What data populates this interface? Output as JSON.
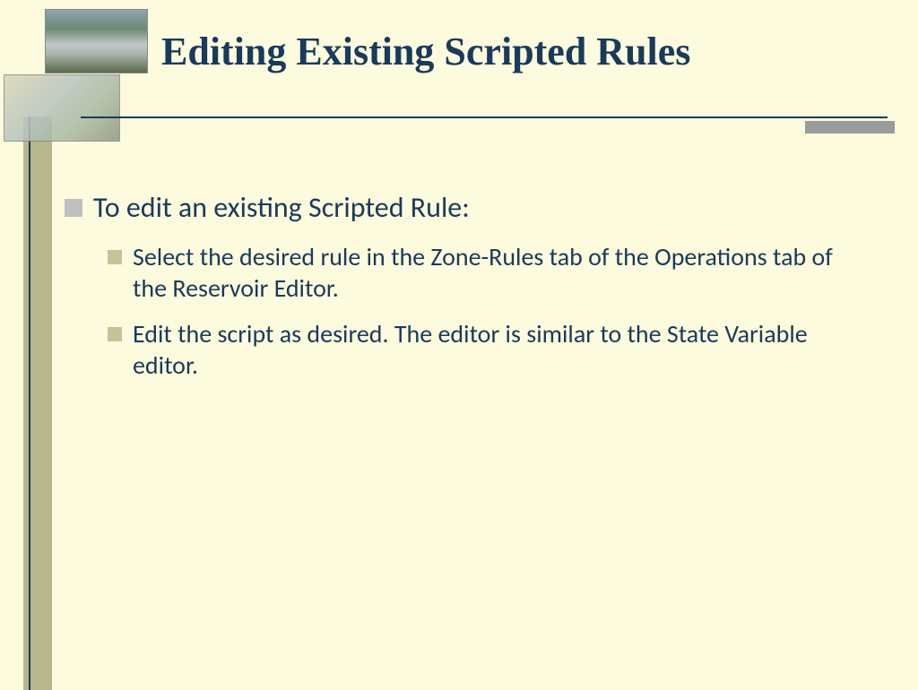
{
  "slide": {
    "title": "Editing Existing Scripted Rules",
    "main_bullet": "To edit an existing Scripted Rule:",
    "sub_bullets": [
      "Select the desired rule in the Zone-Rules tab of the Operations tab of the Reservoir Editor.",
      "Edit the script as desired.  The editor is similar to the State Variable editor."
    ]
  }
}
